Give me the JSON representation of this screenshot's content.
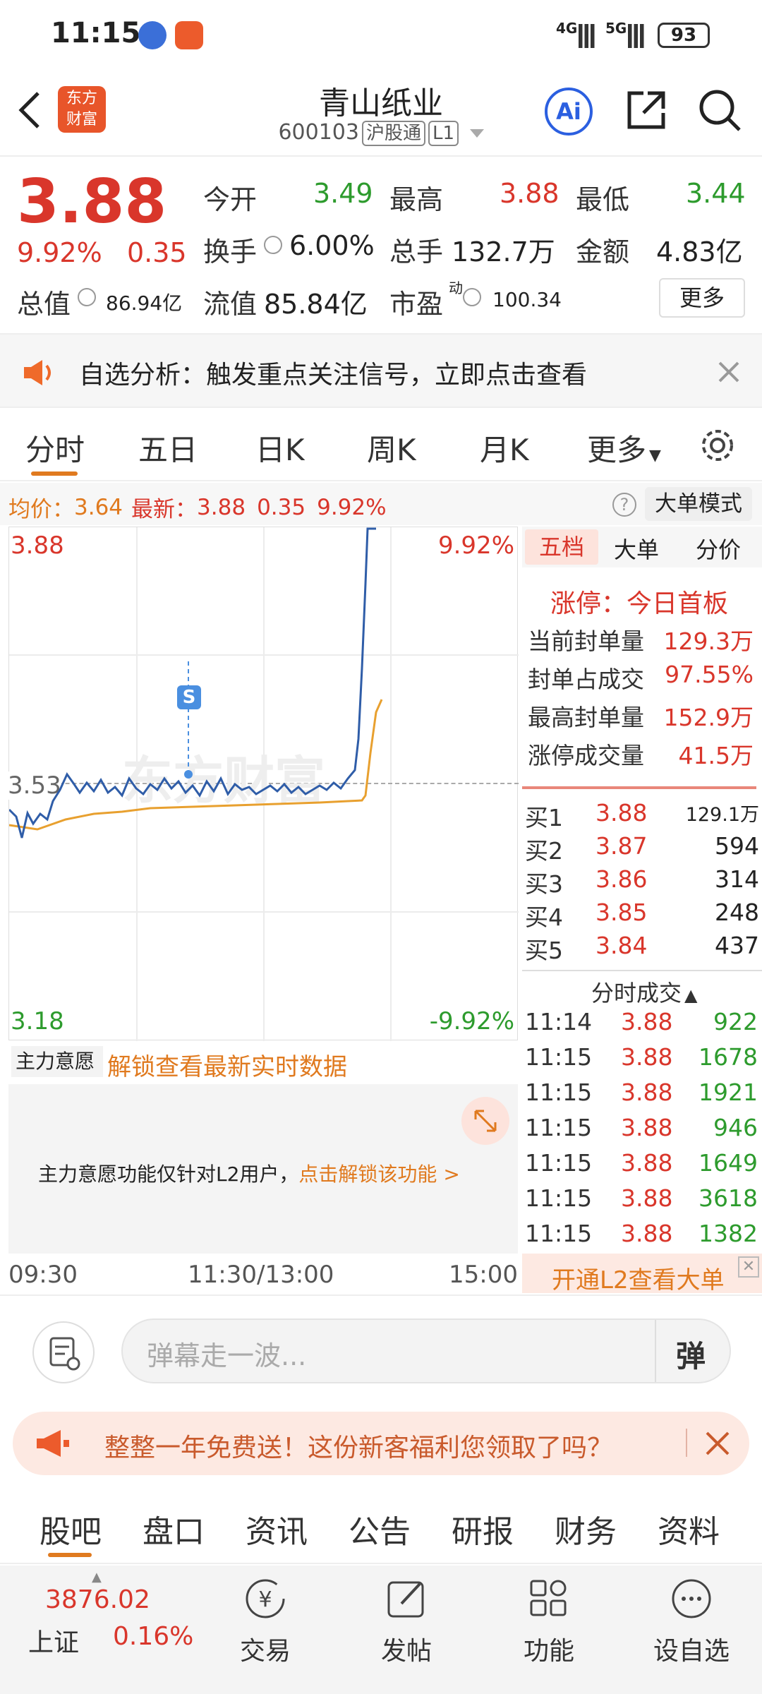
{
  "status_bar": {
    "time": "11:15",
    "network_1": "4G",
    "network_2": "5G",
    "battery": "93"
  },
  "header": {
    "title": "青山纸业",
    "code": "600103",
    "tag1": "沪股通",
    "tag2": "L1",
    "logo_line1": "东方",
    "logo_line2": "财富",
    "ai_label": "Ai"
  },
  "quote": {
    "price": "3.88",
    "change_pct": "9.92%",
    "change": "0.35",
    "open_label": "今开",
    "open": "3.49",
    "high_label": "最高",
    "high": "3.88",
    "low_label": "最低",
    "low": "3.44",
    "turnover_label": "换手",
    "turnover": "6.00%",
    "volume_label": "总手",
    "volume": "132.7万",
    "amount_label": "金额",
    "amount": "4.83亿",
    "mktcap_label": "总值",
    "mktcap": "86.94亿",
    "float_label": "流值",
    "float": "85.84亿",
    "pe_label": "市盈",
    "pe_sup": "动",
    "pe": "100.34",
    "more_button": "更多"
  },
  "notice": {
    "text": "自选分析：触发重点关注信号，立即点击查看"
  },
  "tabs": [
    "分时",
    "五日",
    "日K",
    "周K",
    "月K",
    "更多"
  ],
  "avg_bar": {
    "avg_label": "均价：",
    "avg": "3.64",
    "latest_label": "最新：",
    "latest": "3.88",
    "change": "0.35",
    "pct": "9.92%",
    "mode_button": "大单模式"
  },
  "chart": {
    "y_top": "3.88",
    "y_mid": "3.53",
    "y_bottom": "3.18",
    "pct_top": "9.92%",
    "pct_bottom": "-9.92%",
    "marker": "S",
    "watermark": "东方财富",
    "x_start": "09:30",
    "x_mid": "11:30/13:00",
    "x_end": "15:00",
    "colors": {
      "price": "#2f5da8",
      "avg": "#e8a02f"
    }
  },
  "right_panel": {
    "tabs": [
      "五档",
      "大单",
      "分价"
    ],
    "limit_title": "涨停：今日首板",
    "stats": [
      {
        "label": "当前封单量",
        "value": "129.3万"
      },
      {
        "label": "封单占成交",
        "value": "97.55%"
      },
      {
        "label": "最高封单量",
        "value": "152.9万"
      },
      {
        "label": "涨停成交量",
        "value": "41.5万"
      }
    ],
    "bids": [
      {
        "label": "买1",
        "price": "3.88",
        "vol": "129.1万"
      },
      {
        "label": "买2",
        "price": "3.87",
        "vol": "594"
      },
      {
        "label": "买3",
        "price": "3.86",
        "vol": "314"
      },
      {
        "label": "买4",
        "price": "3.85",
        "vol": "248"
      },
      {
        "label": "买5",
        "price": "3.84",
        "vol": "437"
      }
    ],
    "trades_title": "分时成交",
    "trades": [
      {
        "time": "11:14",
        "price": "3.88",
        "vol": "922"
      },
      {
        "time": "11:15",
        "price": "3.88",
        "vol": "1678"
      },
      {
        "time": "11:15",
        "price": "3.88",
        "vol": "1921"
      },
      {
        "time": "11:15",
        "price": "3.88",
        "vol": "946"
      },
      {
        "time": "11:15",
        "price": "3.88",
        "vol": "1649"
      },
      {
        "time": "11:15",
        "price": "3.88",
        "vol": "3618"
      },
      {
        "time": "11:15",
        "price": "3.88",
        "vol": "1382"
      }
    ],
    "l2_button": "开通L2查看大单"
  },
  "main_will": {
    "select": "主力意愿",
    "unlock_link": "解锁查看最新实时数据",
    "info": "主力意愿功能仅针对L2用户，",
    "info_link": "点击解锁该功能 >"
  },
  "chat": {
    "placeholder": "弹幕走一波...",
    "danmu_label": "弹"
  },
  "promo": {
    "text": "整整一年免费送！这份新客福利您领取了吗？"
  },
  "sub_tabs": [
    "股吧",
    "盘口",
    "资讯",
    "公告",
    "研报",
    "财务",
    "资料"
  ],
  "bottom_nav": {
    "index_value": "3876.02",
    "index_name": "上证",
    "index_pct": "0.16%",
    "items": [
      "交易",
      "发帖",
      "功能",
      "设自选"
    ]
  }
}
